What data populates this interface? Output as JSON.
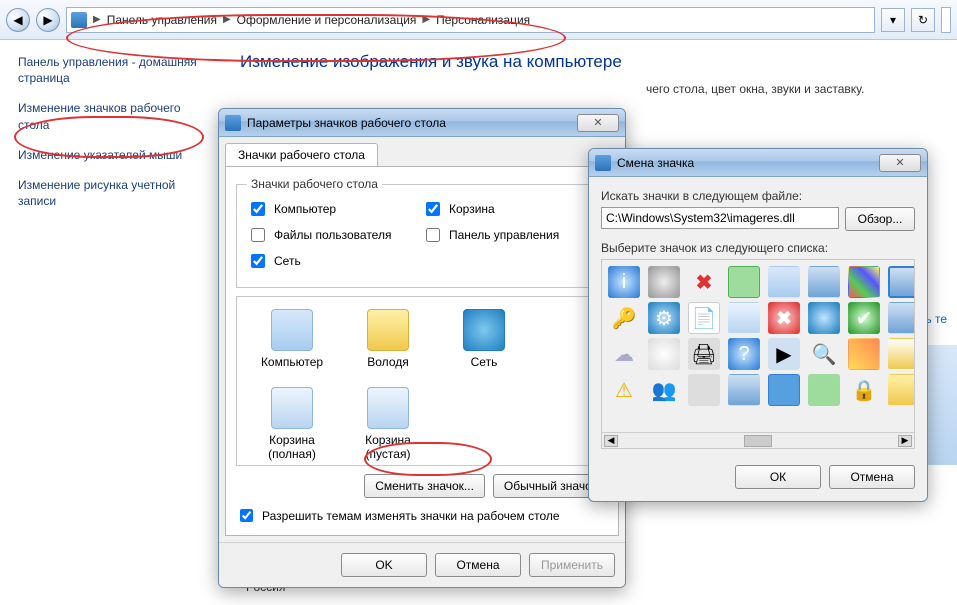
{
  "top": {
    "crumb1": "Панель управления",
    "crumb2": "Оформление и персонализация",
    "crumb3": "Персонализация"
  },
  "sidebar": {
    "home": "Панель управления - домашняя страница",
    "link1": "Изменение значков рабочего стола",
    "link2": "Изменение указателей мыши",
    "link3": "Изменение рисунка учетной записи"
  },
  "page": {
    "title": "Изменение изображения и звука на компьютере",
    "desc_right": "чего стола, цвет окна, звуки и заставку.",
    "region": "Россия",
    "trunc_link": "нить те"
  },
  "dlg1": {
    "title": "Параметры значков рабочего стола",
    "tab": "Значки рабочего стола",
    "group": "Значки рабочего стола",
    "chk_computer": "Компьютер",
    "chk_recycle": "Корзина",
    "chk_userfiles": "Файлы пользователя",
    "chk_controlpanel": "Панель управления",
    "chk_network": "Сеть",
    "icon_computer": "Компьютер",
    "icon_user": "Володя",
    "icon_network": "Сеть",
    "icon_bin_full": "Корзина (полная)",
    "icon_bin_empty": "Корзина (пустая)",
    "btn_change": "Сменить значок...",
    "btn_default": "Обычный значок",
    "allow": "Разрешить темам изменять значки на рабочем столе",
    "ok": "OK",
    "cancel": "Отмена",
    "apply": "Применить"
  },
  "dlg2": {
    "title": "Смена значка",
    "lbl_path": "Искать значки в следующем файле:",
    "path": "C:\\Windows\\System32\\imageres.dll",
    "browse": "Обзор...",
    "lbl_select": "Выберите значок из следующего списка:",
    "ok": "ОК",
    "cancel": "Отмена"
  }
}
